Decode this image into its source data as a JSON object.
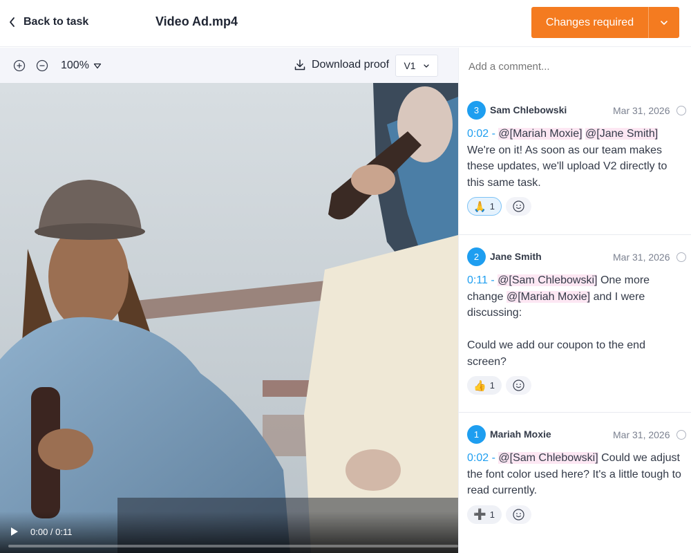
{
  "header": {
    "back_label": "Back to task",
    "file_title": "Video Ad.mp4",
    "status_label": "Changes required",
    "status_color": "#f47b20"
  },
  "toolbar": {
    "zoom": "100%",
    "download_label": "Download proof",
    "version": "V1"
  },
  "video": {
    "timecode": "0:00 / 0:11",
    "progress_fraction": 0.0
  },
  "comments_panel": {
    "input_placeholder": "Add a comment...",
    "comments": [
      {
        "number": "3",
        "author": "Sam Chlebowski",
        "date": "Mar 31, 2026",
        "timestamp": "0:02 -",
        "mentions": [
          "@[Mariah Moxie]",
          "@[Jane Smith]"
        ],
        "text": "We're on it! As soon as our team makes these updates, we'll upload V2 directly to this same task.",
        "reaction_emoji": "🙏",
        "reaction_count": "1"
      },
      {
        "number": "2",
        "author": "Jane Smith",
        "date": "Mar 31, 2026",
        "timestamp": "0:11 -",
        "mention_1": "@[Sam Chlebowski]",
        "text_1": "One more change",
        "mention_2": "@[Mariah Moxie]",
        "text_2": "and I were discussing:",
        "text_3": "Could we add our coupon to the end screen?",
        "reaction_emoji": "👍",
        "reaction_count": "1"
      },
      {
        "number": "1",
        "author": "Mariah Moxie",
        "date": "Mar 31, 2026",
        "timestamp": "0:02 -",
        "mention": "@[Sam Chlebowski]",
        "text": "Could we adjust the font color used here? It's a little tough to read currently.",
        "reaction_emoji": "➕",
        "reaction_count": "1"
      }
    ]
  },
  "accent_color": "#1e9ef0",
  "icons": [
    "chevron-left-icon",
    "chevron-down-icon",
    "zoom-in-icon",
    "zoom-out-icon",
    "caret-down-icon",
    "download-icon",
    "play-icon",
    "smiley-icon",
    "resolve-circle-icon"
  ]
}
